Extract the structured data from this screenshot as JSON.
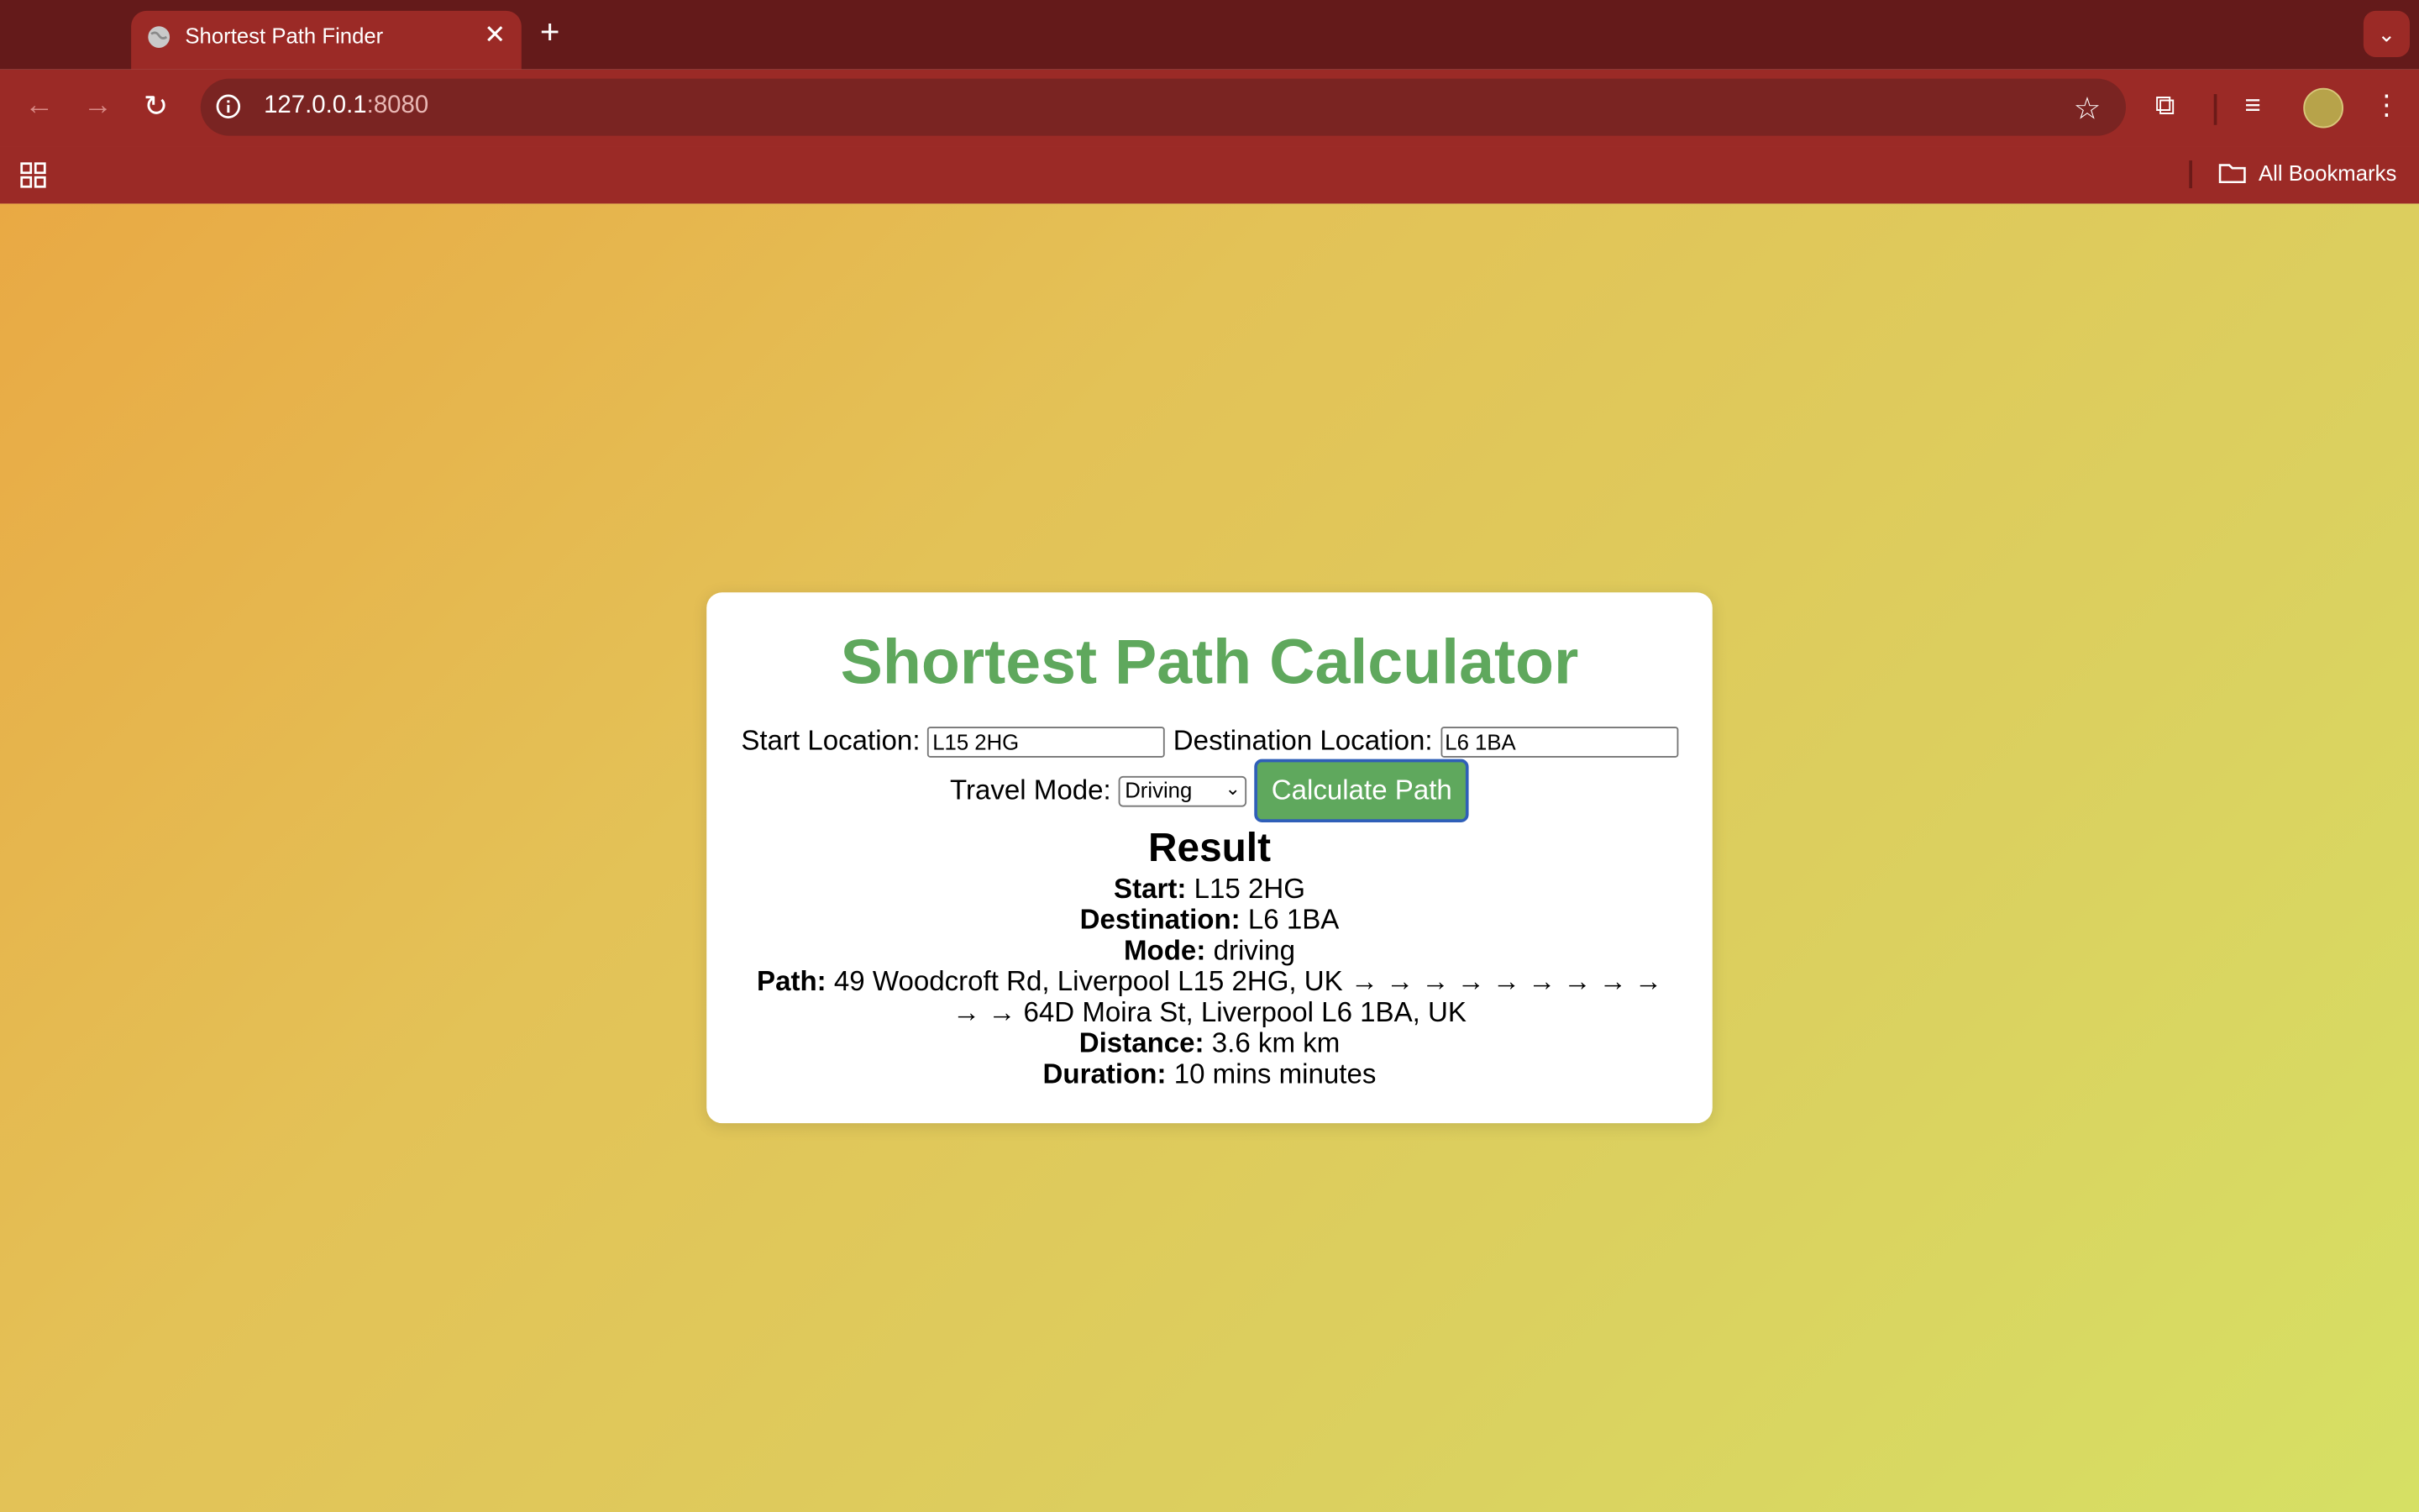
{
  "browser": {
    "tab_title": "Shortest Path Finder",
    "url_host": "127.0.0.1",
    "url_port": ":8080",
    "bookmarks_label": "All Bookmarks"
  },
  "page": {
    "title": "Shortest Path Calculator",
    "start_label": "Start Location:",
    "start_value": "L15 2HG",
    "dest_label": "Destination Location:",
    "dest_value": "L6 1BA",
    "mode_label": "Travel Mode:",
    "mode_value": "Driving",
    "calc_button": "Calculate Path"
  },
  "result": {
    "heading": "Result",
    "start_label": "Start:",
    "start_value": "L15 2HG",
    "dest_label": "Destination:",
    "dest_value": "L6 1BA",
    "mode_label": "Mode:",
    "mode_value": "driving",
    "path_label": "Path:",
    "path_value": "49 Woodcroft Rd, Liverpool L15 2HG, UK → → → → → → → → → → → 64D Moira St, Liverpool L6 1BA, UK",
    "distance_label": "Distance:",
    "distance_value": "3.6 km km",
    "duration_label": "Duration:",
    "duration_value": "10 mins minutes"
  }
}
